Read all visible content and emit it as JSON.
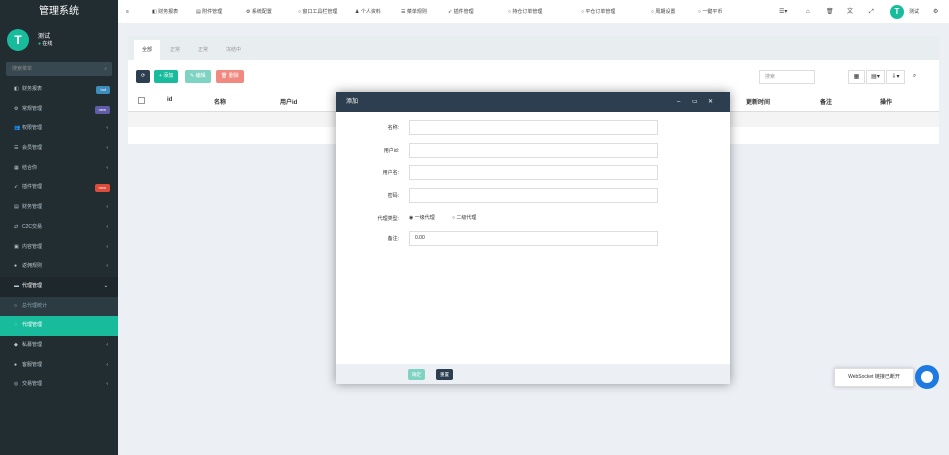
{
  "brand": "管理系统",
  "user": {
    "avatar_letter": "T",
    "name": "测试",
    "status": "在线"
  },
  "sidebar": {
    "search_placeholder": "搜索菜单",
    "search_icon": "search-icon",
    "items": [
      {
        "label": "财务报表",
        "icon": "dashboard-icon",
        "badge": "hot",
        "badge_color": "#3c8dbc"
      },
      {
        "label": "常规管理",
        "icon": "cogs-icon",
        "badge": "new",
        "badge_color": "#605ca8"
      },
      {
        "label": "权限管理",
        "icon": "group-icon",
        "arrow": "‹"
      },
      {
        "label": "会员管理",
        "icon": "list-icon",
        "arrow": "‹"
      },
      {
        "label": "结合你",
        "icon": "calendar-icon",
        "arrow": "‹"
      },
      {
        "label": "插件管理",
        "icon": "rocket-icon",
        "badge": "new",
        "badge_color": "#dd4b39"
      },
      {
        "label": "财务管理",
        "icon": "file-icon",
        "arrow": "‹"
      },
      {
        "label": "C2C交易",
        "icon": "exchange-icon",
        "arrow": "‹"
      },
      {
        "label": "内容管理",
        "icon": "image-icon",
        "arrow": "‹"
      },
      {
        "label": "返佣规则",
        "icon": "circle-icon",
        "arrow": "‹"
      },
      {
        "label": "代理管理",
        "icon": "folder-icon",
        "arrow": "⌄",
        "open": true
      },
      {
        "label": "总代理统计",
        "icon": "circle-o-icon",
        "sub": true
      },
      {
        "label": "代理管理",
        "icon": "circle-o-icon",
        "active": true
      },
      {
        "label": "私募管理",
        "icon": "diamond-icon",
        "arrow": "‹"
      },
      {
        "label": "客服管理",
        "icon": "comment-icon",
        "arrow": "‹"
      },
      {
        "label": "交易管理",
        "icon": "eye-icon",
        "arrow": "‹"
      }
    ]
  },
  "topbar": {
    "menu_icon": "bars-icon",
    "nav": [
      "财务报表",
      "附件管理",
      "系统配置",
      "窗口工具栏管理",
      "个人资料",
      "菜单规则",
      "插件管理",
      "持仓订单管理",
      "平仓订单管理",
      "周期设置",
      "一键平币"
    ],
    "right_icons": [
      "list-icon",
      "home-icon",
      "trash-icon",
      "language-icon",
      "expand-icon"
    ],
    "user_name": "测试"
  },
  "tabs": [
    "全部",
    "正常",
    "正常",
    "冻结中"
  ],
  "toolbar": {
    "refresh_icon": "refresh-icon",
    "add": "添加",
    "edit": "编辑",
    "delete": "删除",
    "search_placeholder": "搜索"
  },
  "table": {
    "columns": [
      "id",
      "名称",
      "用户id",
      "更新时间",
      "备注",
      "操作"
    ]
  },
  "modal": {
    "title": "添加",
    "fields": [
      {
        "label": "名称:",
        "value": ""
      },
      {
        "label": "用户id:",
        "value": ""
      },
      {
        "label": "用户名:",
        "value": ""
      },
      {
        "label": "密码:",
        "value": ""
      }
    ],
    "agent_type_label": "代理类型:",
    "agent_options": [
      "一级代理",
      "二级代理"
    ],
    "agent_selected": 0,
    "remark_label": "备注:",
    "remark_value": "0.00",
    "confirm": "确定",
    "reset": "重置"
  },
  "toast": {
    "text": "WebSocket 链接已断开"
  },
  "colors": {
    "primary": "#18bc9c",
    "sidebar_bg": "#222d32",
    "modal_header": "#2c3e50",
    "danger": "#e74c3c",
    "info": "#3498db"
  }
}
